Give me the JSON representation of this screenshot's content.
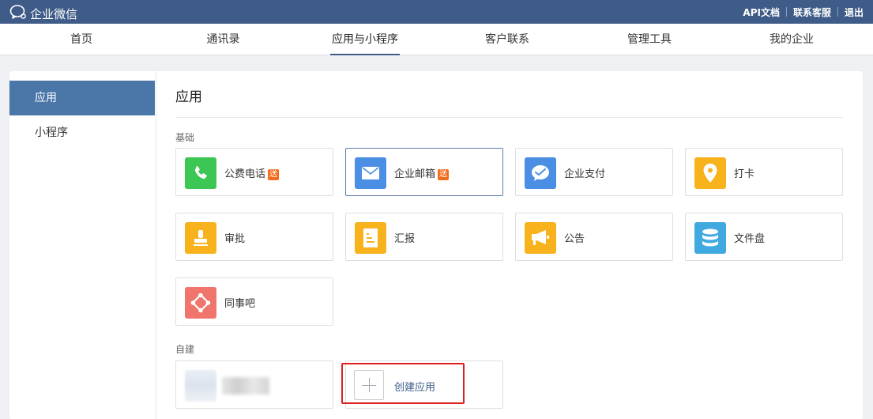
{
  "topbar": {
    "brand": "企业微信",
    "links": [
      "API文档",
      "联系客服",
      "退出"
    ]
  },
  "nav": {
    "items": [
      "首页",
      "通讯录",
      "应用与小程序",
      "客户联系",
      "管理工具",
      "我的企业"
    ],
    "active": "应用与小程序"
  },
  "sidebar": {
    "items": [
      "应用",
      "小程序"
    ],
    "active": "应用"
  },
  "main": {
    "title": "应用",
    "sections": {
      "basic": "基础",
      "custom": "自建"
    },
    "apps": [
      {
        "name": "公费电话",
        "badge": "送",
        "icon": "phone-icon",
        "color": "#3cc653"
      },
      {
        "name": "企业邮箱",
        "badge": "送",
        "icon": "mail-icon",
        "color": "#4a8fe3"
      },
      {
        "name": "企业支付",
        "badge": "",
        "icon": "wallet-icon",
        "color": "#4a8fe3"
      },
      {
        "name": "打卡",
        "badge": "",
        "icon": "location-pin-icon",
        "color": "#f7b21c"
      },
      {
        "name": "审批",
        "badge": "",
        "icon": "stamp-icon",
        "color": "#f7b21c"
      },
      {
        "name": "汇报",
        "badge": "",
        "icon": "report-icon",
        "color": "#f7b21c"
      },
      {
        "name": "公告",
        "badge": "",
        "icon": "megaphone-icon",
        "color": "#f7b21c"
      },
      {
        "name": "文件盘",
        "badge": "",
        "icon": "database-icon",
        "color": "#40a9e0"
      },
      {
        "name": "同事吧",
        "badge": "",
        "icon": "network-icon",
        "color": "#f0756d"
      }
    ],
    "create": {
      "label": "创建应用"
    }
  },
  "colors": {
    "topbar": "#3e5c87",
    "sidebar_active": "#4a76a8",
    "badge": "#f36b1c",
    "highlight_outline": "#e02020"
  }
}
